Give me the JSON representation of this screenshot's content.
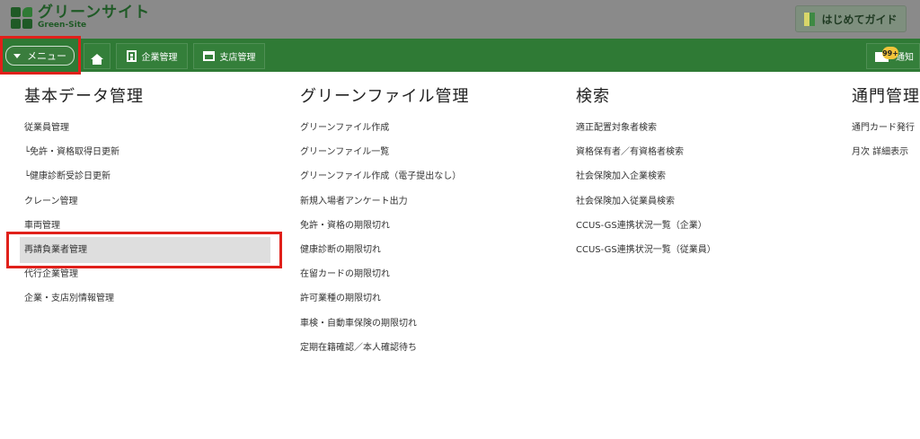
{
  "header": {
    "logo_title": "グリーンサイト",
    "logo_subtitle": "Green-Site",
    "guide_label": "はじめてガイド"
  },
  "nav": {
    "menu_label": "メニュー",
    "company_label": "企業管理",
    "branch_label": "支店管理",
    "notice_label": "通知",
    "notice_badge": "99+"
  },
  "columns": [
    {
      "title": "基本データ管理",
      "items": [
        "従業員管理",
        "└免許・資格取得日更新",
        "└健康診断受診日更新",
        "クレーン管理",
        "車両管理",
        "再請負業者管理",
        "代行企業管理",
        "企業・支店別情報管理"
      ]
    },
    {
      "title": "グリーンファイル管理",
      "items": [
        "グリーンファイル作成",
        "グリーンファイル一覧",
        "グリーンファイル作成（電子提出なし）",
        "新規入場者アンケート出力",
        "免許・資格の期限切れ",
        "健康診断の期限切れ",
        "在留カードの期限切れ",
        "許可業種の期限切れ",
        "車検・自動車保険の期限切れ",
        "定期在籍確認／本人確認待ち"
      ]
    },
    {
      "title": "検索",
      "items": [
        "適正配置対象者検索",
        "資格保有者／有資格者検索",
        "社会保険加入企業検索",
        "社会保険加入従業員検索",
        "CCUS-GS連携状況一覧（企業）",
        "CCUS-GS連携状況一覧（従業員）"
      ]
    },
    {
      "title": "通門管理",
      "items": [
        "通門カード発行",
        "月次 詳細表示"
      ]
    }
  ],
  "colors": {
    "nav_green": "#2f7a35",
    "header_gray": "#8a8a8a",
    "highlight_red": "#e0201a"
  },
  "icons": [
    "logo-mark-icon",
    "caret-down-icon",
    "home-icon",
    "building-icon",
    "shop-icon",
    "mail-icon",
    "beginner-mark-icon"
  ]
}
